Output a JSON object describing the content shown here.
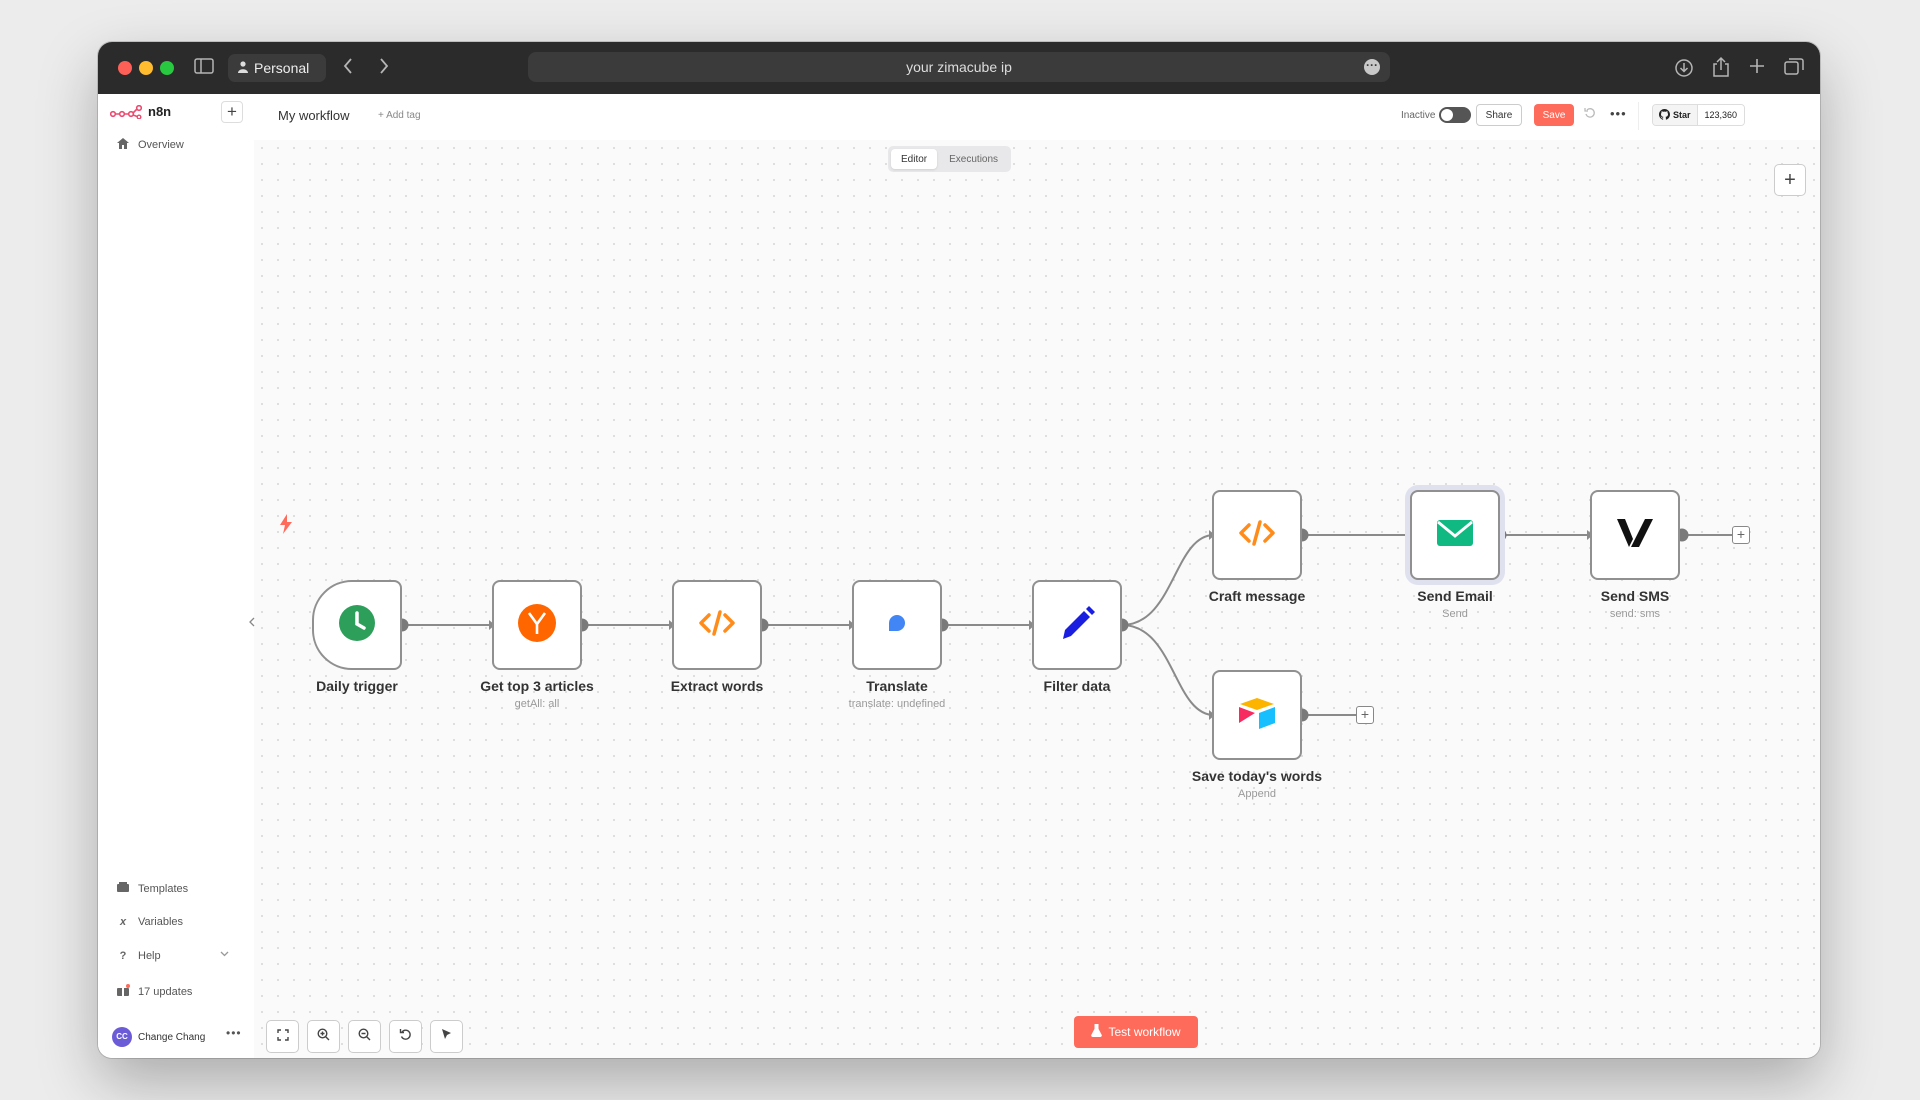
{
  "browser": {
    "profile_label": "Personal",
    "address": "your zimacube ip"
  },
  "sidebar": {
    "logo_text": "n8n",
    "items": [
      {
        "label": "Overview",
        "icon": "home-icon"
      },
      {
        "label": "Templates",
        "icon": "templates-icon"
      },
      {
        "label": "Variables",
        "icon": "variables-icon"
      },
      {
        "label": "Help",
        "icon": "help-icon"
      },
      {
        "label": "17 updates",
        "icon": "gift-icon"
      }
    ],
    "user": {
      "initials": "CC",
      "name": "Change Chang"
    }
  },
  "header": {
    "workflow_name": "My workflow",
    "add_tag": "+ Add tag",
    "inactive_label": "Inactive",
    "share_label": "Share",
    "save_label": "Save",
    "github_star": "Star",
    "github_count": "123,360"
  },
  "tabs": [
    {
      "label": "Editor",
      "active": true
    },
    {
      "label": "Executions",
      "active": false
    }
  ],
  "nodes": [
    {
      "id": "daily-trigger",
      "label": "Daily trigger",
      "subtitle": ""
    },
    {
      "id": "get-top-articles",
      "label": "Get top 3 articles",
      "subtitle": "getAll: all"
    },
    {
      "id": "extract-words",
      "label": "Extract words",
      "subtitle": ""
    },
    {
      "id": "translate",
      "label": "Translate",
      "subtitle": "translate: undefined"
    },
    {
      "id": "filter-data",
      "label": "Filter data",
      "subtitle": ""
    },
    {
      "id": "craft-message",
      "label": "Craft message",
      "subtitle": ""
    },
    {
      "id": "send-email",
      "label": "Send Email",
      "subtitle": "Send"
    },
    {
      "id": "send-sms",
      "label": "Send SMS",
      "subtitle": "send: sms"
    },
    {
      "id": "save-words",
      "label": "Save today's words",
      "subtitle": "Append"
    }
  ],
  "test_workflow_label": "Test workflow",
  "colors": {
    "accent": "#ff6b5b",
    "clock_green": "#2e9e5b",
    "hn_orange": "#ff6600",
    "code_orange": "#ff8c1a",
    "email_green": "#10b981",
    "pen_blue": "#1a1ee0"
  }
}
